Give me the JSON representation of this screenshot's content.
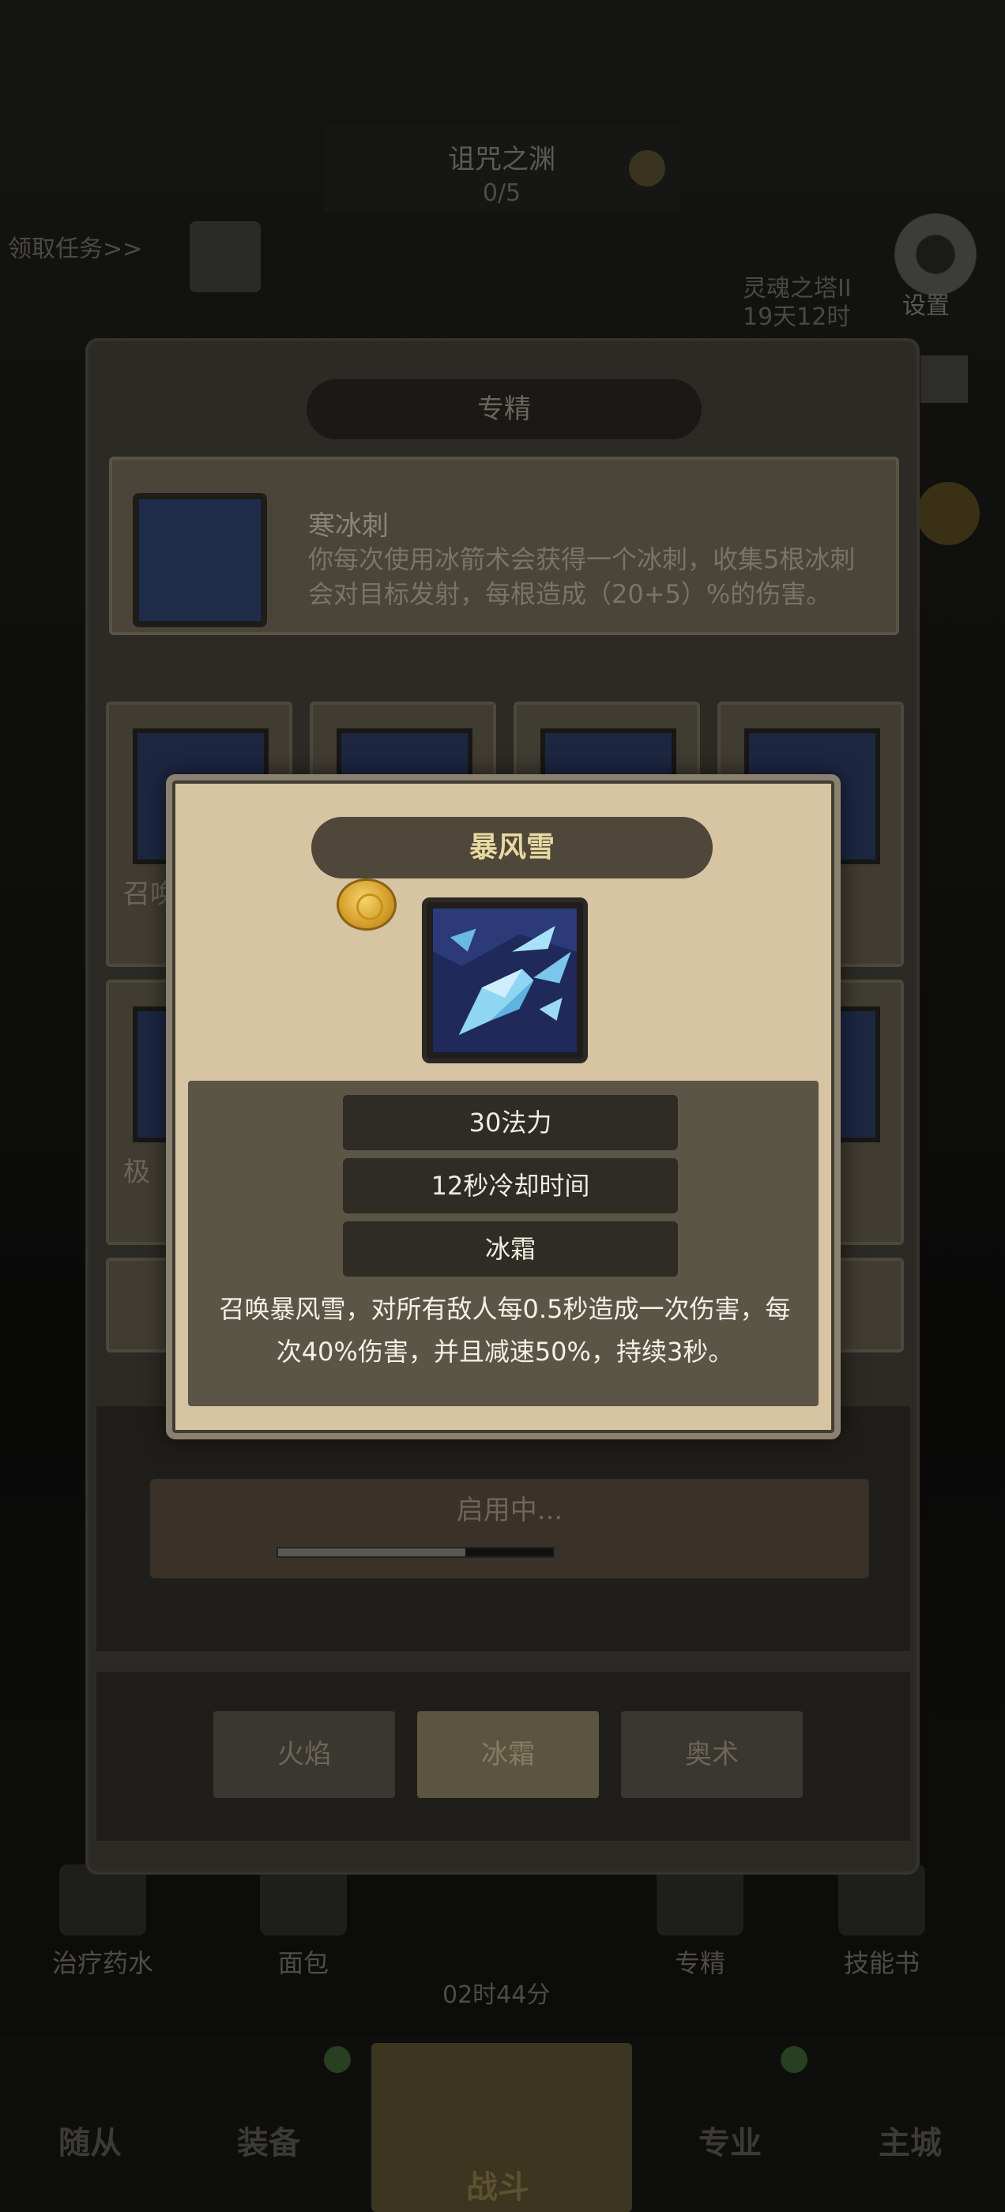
{
  "background": {
    "dungeon_title": "诅咒之渊",
    "dungeon_progress": "0/5",
    "task_link": "领取任务>>",
    "settings_label": "设置",
    "realm_label": "灵魂之塔II",
    "realm_time": "19天12时",
    "items": [
      {
        "label": "治疗药水"
      },
      {
        "label": "面包"
      },
      {
        "label": "专精"
      },
      {
        "label": "技能书"
      }
    ],
    "timer": "02时44分",
    "nav": {
      "companions": "随从",
      "equipment": "装备",
      "battle": "战斗",
      "profession": "专业",
      "city": "主城"
    }
  },
  "panel": {
    "title": "专精",
    "talent": {
      "name": "寒冰刺",
      "description": "你每次使用冰箭术会获得一个冰刺，收集5根冰刺会对目标发射，每根造成（20+5）%的伤害。"
    },
    "grid_labels": [
      "召唤",
      "",
      "",
      "",
      "极",
      ""
    ],
    "start_label": "启用中...",
    "progress_fraction": 0.68,
    "schools": [
      "火焰",
      "冰霜",
      "奥术"
    ],
    "active_school": "冰霜"
  },
  "popup": {
    "title": "暴风雪",
    "stats": [
      "30法力",
      "12秒冷却时间",
      "冰霜"
    ],
    "description": "召唤暴风雪，对所有敌人每0.5秒造成一次伤害，每次40%伤害，并且减速50%，持续3秒。",
    "colors": {
      "title_text": "#e8d9a0",
      "parchment": "#d6c4a2",
      "info_bg": "#5b5546"
    }
  }
}
